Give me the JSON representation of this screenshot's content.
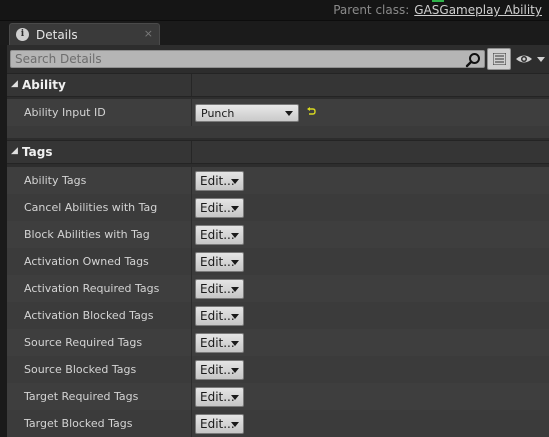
{
  "topbar": {
    "parent_class_label": "Parent class:",
    "parent_class_value": "GASGameplay Ability"
  },
  "tab": {
    "label": "Details",
    "close": "×",
    "icon": "info-icon"
  },
  "search": {
    "placeholder": "Search Details",
    "value": ""
  },
  "categories": {
    "ability": {
      "label": "Ability",
      "arrow": "◢"
    },
    "tags": {
      "label": "Tags",
      "arrow": "◢"
    }
  },
  "ability": {
    "input_id_label": "Ability Input ID",
    "input_id_value": "Punch"
  },
  "tags": {
    "edit_label": "Edit...",
    "rows": [
      "Ability Tags",
      "Cancel Abilities with Tag",
      "Block Abilities with Tag",
      "Activation Owned Tags",
      "Activation Required Tags",
      "Activation Blocked Tags",
      "Source Required Tags",
      "Source Blocked Tags",
      "Target Required Tags",
      "Target Blocked Tags"
    ]
  },
  "colors": {
    "panel_bg": "#2d2d2d",
    "row_bg": "#3e3e3e",
    "category_bg": "#353535",
    "reset_arrow": "#d8d820"
  }
}
